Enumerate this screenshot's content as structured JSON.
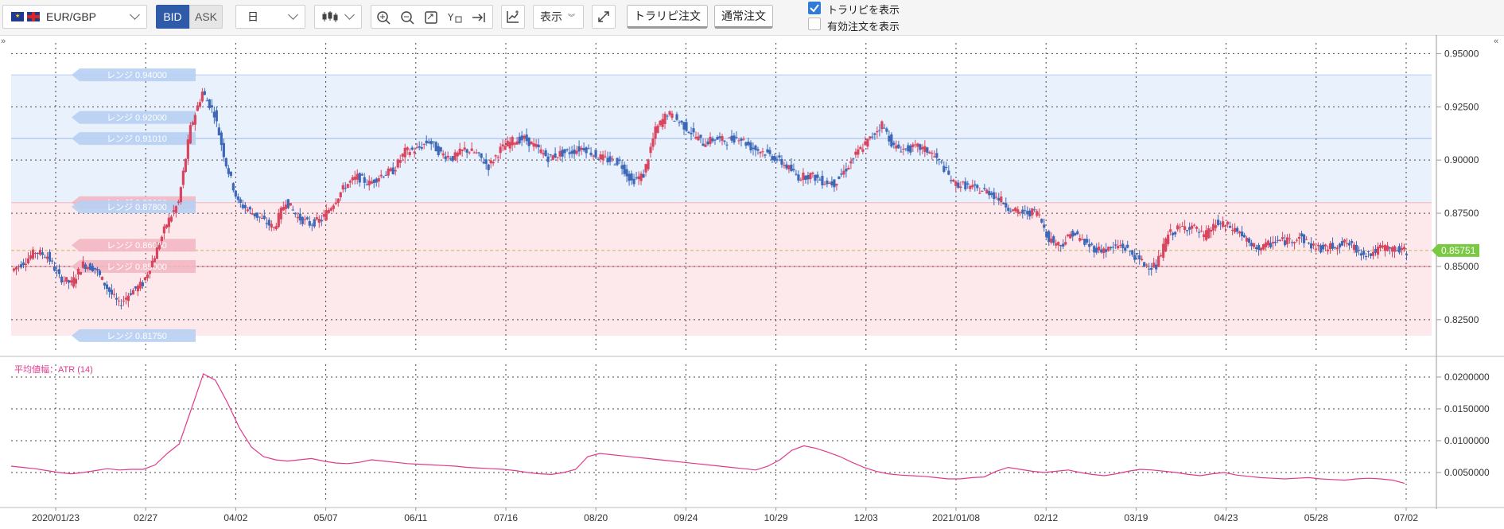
{
  "toolbar": {
    "symbol": "EUR/GBP",
    "bid_label": "BID",
    "ask_label": "ASK",
    "timeframe": "日",
    "display_label": "表示",
    "trailing_order_label": "トラリピ注文",
    "normal_order_label": "通常注文",
    "show_trailing_label": "トラリピを表示",
    "show_trailing_checked": true,
    "show_active_orders_label": "有効注文を表示",
    "show_active_orders_checked": false
  },
  "icons": [
    "candle-type-icon",
    "zoom-in-icon",
    "zoom-out-icon",
    "fit-icon",
    "y-axis-icon",
    "scroll-end-icon",
    "indicator-icon",
    "fullscreen-icon"
  ],
  "colors": {
    "up": "#d9455f",
    "down": "#3d68b8",
    "atr": "#e03a8c",
    "current_price_tag": "#7ac943",
    "sell_zone": "#e9f1fd",
    "buy_zone": "#fde9ec"
  },
  "chart_data": {
    "type": "candlestick",
    "price_axis": {
      "ylim": [
        0.81,
        0.955
      ],
      "ticks": [
        "0.95000",
        "0.92500",
        "0.90000",
        "0.87500",
        "0.85000",
        "0.82500"
      ]
    },
    "x_ticks": [
      "2020/01/23",
      "02/27",
      "04/02",
      "05/07",
      "06/11",
      "07/16",
      "08/20",
      "09/24",
      "10/29",
      "12/03",
      "2021/01/08",
      "02/12",
      "03/19",
      "04/23",
      "05/28",
      "07/02"
    ],
    "current_price": "0.85751",
    "range_labels": [
      {
        "text": "レンジ 0.94000",
        "kind": "sell"
      },
      {
        "text": "レンジ 0.92000",
        "kind": "sell"
      },
      {
        "text": "レンジ 0.91010",
        "kind": "sell"
      },
      {
        "text": "レンジ 0.88000",
        "kind": "buy"
      },
      {
        "text": "レンジ 0.87800",
        "kind": "sell"
      },
      {
        "text": "レンジ 0.86000",
        "kind": "buy"
      },
      {
        "text": "レンジ 0.85000",
        "kind": "buy"
      },
      {
        "text": "レンジ 0.81750",
        "kind": "sell"
      }
    ],
    "close_series": [
      0.848,
      0.852,
      0.857,
      0.855,
      0.845,
      0.842,
      0.851,
      0.849,
      0.84,
      0.832,
      0.838,
      0.842,
      0.855,
      0.87,
      0.88,
      0.915,
      0.932,
      0.922,
      0.898,
      0.88,
      0.876,
      0.872,
      0.868,
      0.881,
      0.873,
      0.87,
      0.872,
      0.88,
      0.888,
      0.892,
      0.889,
      0.893,
      0.895,
      0.904,
      0.905,
      0.909,
      0.903,
      0.901,
      0.905,
      0.903,
      0.897,
      0.905,
      0.909,
      0.91,
      0.906,
      0.901,
      0.903,
      0.904,
      0.906,
      0.902,
      0.9,
      0.899,
      0.89,
      0.893,
      0.914,
      0.922,
      0.918,
      0.913,
      0.908,
      0.91,
      0.909,
      0.911,
      0.906,
      0.904,
      0.901,
      0.897,
      0.892,
      0.893,
      0.89,
      0.889,
      0.896,
      0.904,
      0.91,
      0.917,
      0.906,
      0.905,
      0.906,
      0.904,
      0.898,
      0.889,
      0.888,
      0.886,
      0.885,
      0.881,
      0.876,
      0.875,
      0.876,
      0.863,
      0.86,
      0.866,
      0.861,
      0.858,
      0.858,
      0.86,
      0.856,
      0.851,
      0.85,
      0.865,
      0.868,
      0.869,
      0.864,
      0.87,
      0.869,
      0.866,
      0.859,
      0.859,
      0.862,
      0.862,
      0.864,
      0.86,
      0.858,
      0.86,
      0.861,
      0.857,
      0.856,
      0.859,
      0.858,
      0.857
    ],
    "atr": {
      "label": "平均値幅：ATR (14)",
      "ylim": [
        0.0,
        0.0215
      ],
      "ticks": [
        "0.0200000",
        "0.0150000",
        "0.0100000",
        "0.0050000"
      ],
      "values": [
        0.006,
        0.0058,
        0.0056,
        0.0053,
        0.005,
        0.0048,
        0.005,
        0.0053,
        0.0056,
        0.0054,
        0.0055,
        0.0055,
        0.0062,
        0.008,
        0.0095,
        0.015,
        0.0205,
        0.0195,
        0.016,
        0.012,
        0.009,
        0.0075,
        0.007,
        0.0068,
        0.007,
        0.0072,
        0.0068,
        0.0065,
        0.0064,
        0.0066,
        0.007,
        0.0068,
        0.0066,
        0.0064,
        0.0063,
        0.0062,
        0.0061,
        0.006,
        0.0058,
        0.0057,
        0.0056,
        0.0055,
        0.0053,
        0.005,
        0.0048,
        0.0047,
        0.005,
        0.0055,
        0.0075,
        0.008,
        0.0078,
        0.0076,
        0.0074,
        0.0072,
        0.007,
        0.0068,
        0.0066,
        0.0064,
        0.0062,
        0.006,
        0.0058,
        0.0056,
        0.0054,
        0.006,
        0.007,
        0.0085,
        0.0092,
        0.0088,
        0.0082,
        0.0075,
        0.0066,
        0.0058,
        0.0052,
        0.0048,
        0.0046,
        0.0045,
        0.0044,
        0.0042,
        0.004,
        0.004,
        0.0042,
        0.0043,
        0.0052,
        0.0058,
        0.0055,
        0.0052,
        0.005,
        0.0052,
        0.0054,
        0.005,
        0.0047,
        0.0045,
        0.0048,
        0.0052,
        0.0055,
        0.0054,
        0.0052,
        0.005,
        0.0047,
        0.0045,
        0.0048,
        0.005,
        0.0046,
        0.0044,
        0.0042,
        0.0041,
        0.004,
        0.0041,
        0.0042,
        0.004,
        0.0039,
        0.0038,
        0.004,
        0.0041,
        0.004,
        0.0038,
        0.0033
      ]
    }
  }
}
